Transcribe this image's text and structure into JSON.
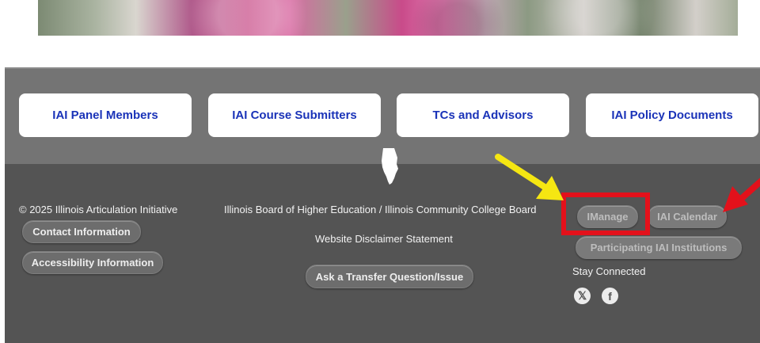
{
  "nav_buttons": [
    "IAI Panel Members",
    "IAI Course Submitters",
    "TCs and Advisors",
    "IAI Policy Documents"
  ],
  "footer": {
    "copyright": "© 2025 Illinois Articulation Initiative",
    "contact_label": "Contact Information",
    "accessibility_label": "Accessibility Information",
    "board_text": "Illinois Board of Higher Education / Illinois Community College Board",
    "disclaimer": "Website Disclaimer Statement",
    "ask_label": "Ask a Transfer Question/Issue",
    "imanage_label": "IManage",
    "calendar_label": "IAI Calendar",
    "participating_label": "Participating IAI Institutions",
    "stay_connected": "Stay Connected",
    "social": [
      "x-icon",
      "facebook-icon"
    ]
  },
  "colors": {
    "nav_text": "#1a33b8",
    "annotation_yellow": "#f5e612",
    "annotation_red": "#e3111b"
  }
}
